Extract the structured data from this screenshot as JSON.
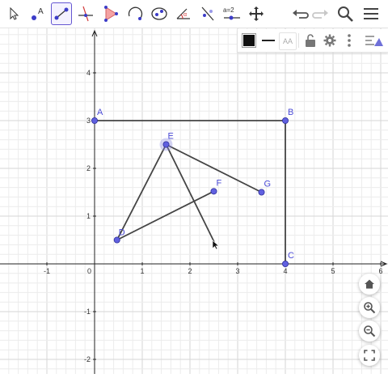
{
  "toolbar": {
    "tools": [
      {
        "name": "move-tool-icon"
      },
      {
        "name": "point-tool-icon",
        "label": "A"
      },
      {
        "name": "segment-tool-icon",
        "selected": true
      },
      {
        "name": "perpendicular-line-tool-icon"
      },
      {
        "name": "polygon-tool-icon"
      },
      {
        "name": "circle-arc-tool-icon"
      },
      {
        "name": "ellipse-tool-icon"
      },
      {
        "name": "angle-tool-icon"
      },
      {
        "name": "reflect-tool-icon"
      },
      {
        "name": "slider-tool-icon",
        "label": "a=2"
      },
      {
        "name": "move-graphics-view-tool-icon"
      }
    ],
    "accent_color": "#6557d2"
  },
  "stylebar": {
    "font_size_label": "AA"
  },
  "axes": {
    "x_ticks": [
      "-1",
      "0",
      "1",
      "2",
      "3",
      "4",
      "5",
      "6"
    ],
    "y_ticks": [
      "4",
      "3",
      "2",
      "1",
      "-1",
      "-2"
    ],
    "xlim": [
      -2,
      6
    ],
    "ylim": [
      -2.3,
      4.9
    ],
    "grid": true
  },
  "points": [
    {
      "label": "A",
      "x": 0,
      "y": 3
    },
    {
      "label": "B",
      "x": 4,
      "y": 3
    },
    {
      "label": "C",
      "x": 4,
      "y": 0
    },
    {
      "label": "D",
      "x": 0.47,
      "y": 0.5
    },
    {
      "label": "E",
      "x": 1.5,
      "y": 2.5
    },
    {
      "label": "F",
      "x": 2.5,
      "y": 1.52
    },
    {
      "label": "G",
      "x": 3.5,
      "y": 1.5
    }
  ],
  "segments": [
    [
      "A",
      "B"
    ],
    [
      "B",
      "C"
    ],
    [
      "D",
      "E"
    ],
    [
      "E",
      "G"
    ],
    [
      "D",
      "F"
    ]
  ],
  "colors": {
    "point_fill": "#6060e0",
    "point_label": "#4b4bd6",
    "segment": "#444444",
    "grid_minor": "#ececec",
    "grid_major": "#d6d6d6",
    "axis": "#222222"
  }
}
